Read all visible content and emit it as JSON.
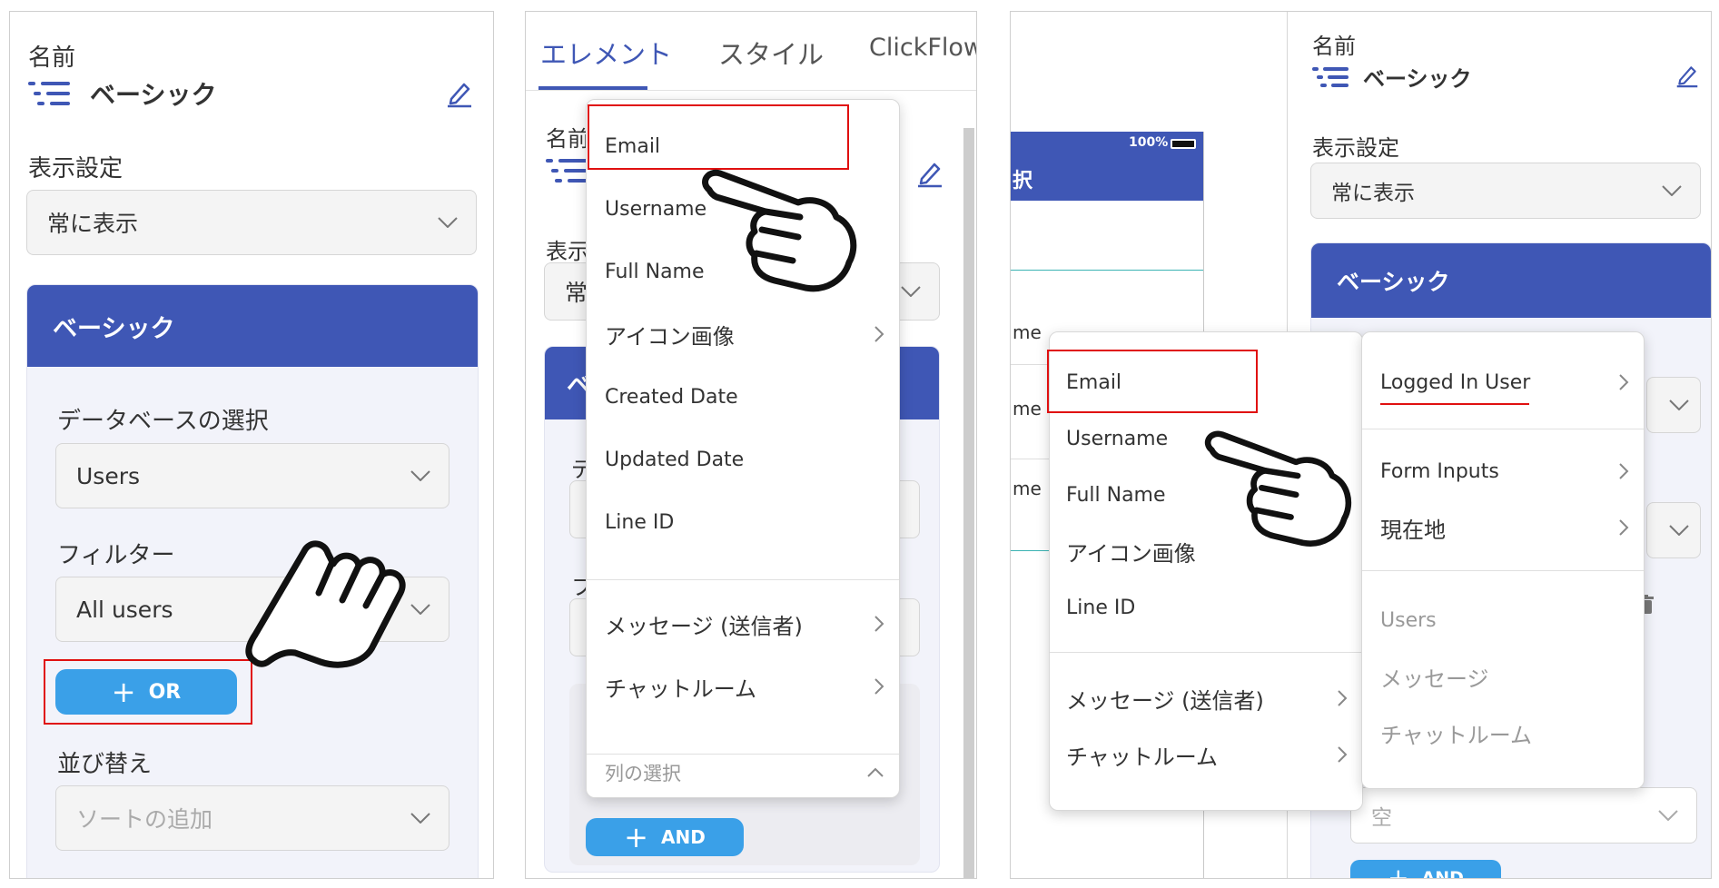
{
  "panel1": {
    "name_label": "名前",
    "name_value": "ベーシック",
    "display_label": "表示設定",
    "display_value": "常に表示",
    "card_title": "ベーシック",
    "db_label": "データベースの選択",
    "db_value": "Users",
    "filter_label": "フィルター",
    "filter_value": "All users",
    "or_button": "OR",
    "sort_label": "並び替え",
    "sort_placeholder": "ソートの追加"
  },
  "panel2": {
    "tabs": [
      "エレメント",
      "スタイル",
      "ClickFlow"
    ],
    "name_label_partial": "名前",
    "display_label_partial": "表示",
    "display_value_partial": "常",
    "card_title_partial": "ベ",
    "db_label_partial": "デ",
    "filter_label_partial": "フ",
    "and_button": "AND",
    "dropdown": {
      "items": [
        "Email",
        "Username",
        "Full Name",
        "アイコン画像",
        "Created Date",
        "Updated Date",
        "Line ID"
      ],
      "group_items": [
        "メッセージ (送信者)",
        "チャットルーム"
      ],
      "column_select": "列の選択"
    }
  },
  "panel3": {
    "status_battery": "100%",
    "header_partial": "択",
    "list_items_partial": [
      "me",
      "me",
      "me"
    ],
    "name_label": "名前",
    "name_value": "ベーシック",
    "display_label": "表示設定",
    "display_value": "常に表示",
    "card_title": "ベーシック",
    "empty_placeholder": "空",
    "and_button": "AND",
    "dropdown_left": {
      "items": [
        "Email",
        "Username",
        "Full Name",
        "アイコン画像",
        "Line ID"
      ],
      "group_items": [
        "メッセージ (送信者)",
        "チャットルーム"
      ]
    },
    "dropdown_right": {
      "items": [
        "Logged In User",
        "Form Inputs",
        "現在地"
      ],
      "dim_items": [
        "Users",
        "メッセージ",
        "チャットルーム"
      ]
    }
  },
  "colors": {
    "primary": "#3f57b5",
    "button_blue": "#3aa0e8",
    "highlight_red": "#e01010"
  }
}
